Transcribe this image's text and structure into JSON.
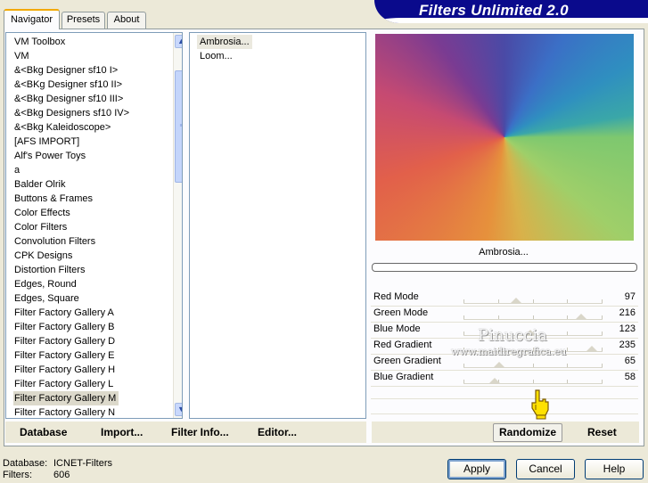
{
  "window": {
    "banner_title": "Filters Unlimited 2.0"
  },
  "tabs": [
    {
      "label": "Navigator",
      "active": true
    },
    {
      "label": "Presets",
      "active": false
    },
    {
      "label": "About",
      "active": false
    }
  ],
  "categories": {
    "selected": "Filter Factory Gallery M",
    "items": [
      "VM Toolbox",
      "VM",
      "&<Bkg Designer sf10 I>",
      "&<BKg Designer sf10 II>",
      "&<Bkg Designer sf10 III>",
      "&<Bkg Designers sf10 IV>",
      "&<Bkg Kaleidoscope>",
      "[AFS IMPORT]",
      "Alf's Power Toys",
      "a",
      "Balder Olrik",
      "Buttons & Frames",
      "Color Effects",
      "Color Filters",
      "Convolution Filters",
      "CPK Designs",
      "Distortion Filters",
      "Edges, Round",
      "Edges, Square",
      "Filter Factory Gallery A",
      "Filter Factory Gallery B",
      "Filter Factory Gallery D",
      "Filter Factory Gallery E",
      "Filter Factory Gallery H",
      "Filter Factory Gallery L",
      "Filter Factory Gallery M",
      "Filter Factory Gallery N"
    ]
  },
  "filters": {
    "items": [
      "Ambrosia...",
      "Loom..."
    ],
    "selected": "Ambrosia..."
  },
  "preview": {
    "filter_name": "Ambrosia..."
  },
  "parameters": [
    {
      "label": "Red Mode",
      "value": "97"
    },
    {
      "label": "Green Mode",
      "value": "216"
    },
    {
      "label": "Blue Mode",
      "value": "123"
    },
    {
      "label": "Red Gradient",
      "value": "235"
    },
    {
      "label": "Green Gradient",
      "value": "65"
    },
    {
      "label": "Blue Gradient",
      "value": "58"
    }
  ],
  "watermark": {
    "line1": "Pinuccia",
    "line2": "www.maidiregrafica.eu"
  },
  "bottom_links": {
    "database": "Database",
    "import": "Import...",
    "filter_info": "Filter Info...",
    "editor": "Editor...",
    "randomize": "Randomize",
    "reset": "Reset"
  },
  "status": {
    "database_label": "Database:",
    "database_value": "ICNET-Filters",
    "filters_label": "Filters:",
    "filters_value": "606"
  },
  "dialog_buttons": {
    "apply": "Apply",
    "cancel": "Cancel",
    "help": "Help"
  },
  "colors": {
    "banner": "#0a0a8c",
    "tab_highlight": "#f2a900",
    "selection": "#dcd9cb"
  },
  "icons": {
    "scroll_up": "chevron-up-icon",
    "scroll_down": "chevron-down-icon",
    "pointer": "hand-pointer-icon"
  }
}
